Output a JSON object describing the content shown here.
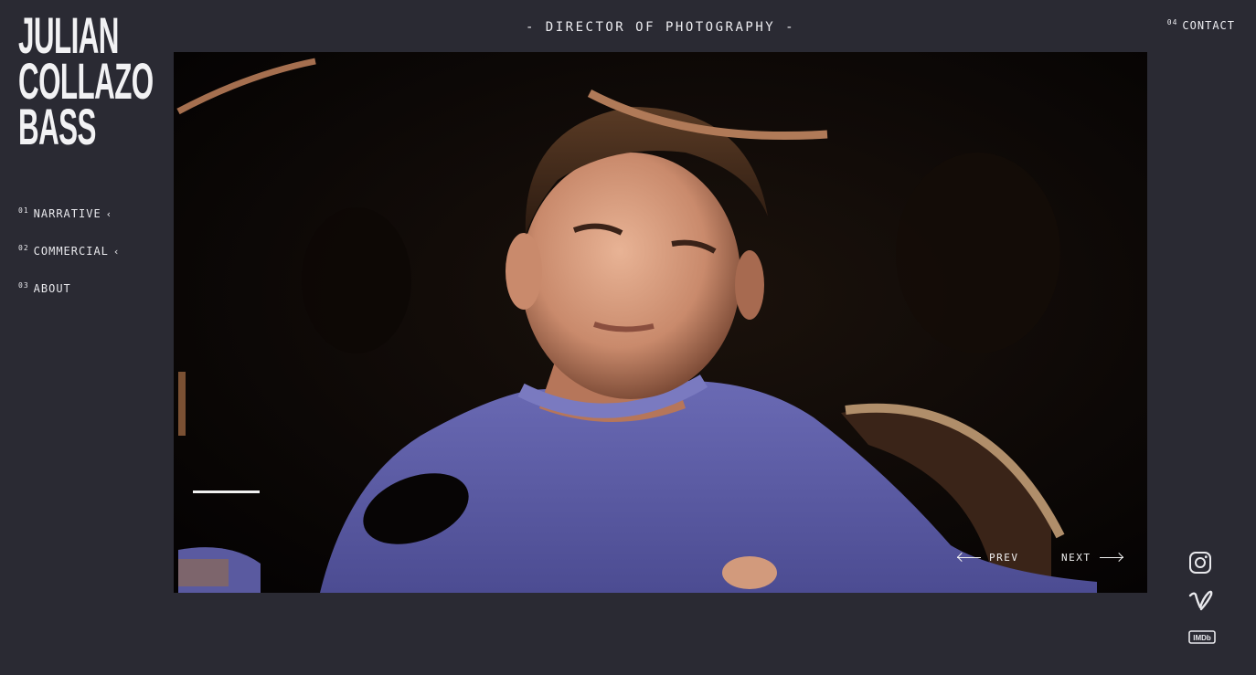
{
  "brand": {
    "logo_lines": [
      "JULIAN",
      "COLLAZO",
      "BASS"
    ]
  },
  "header": {
    "title": "- DIRECTOR OF PHOTOGRAPHY -"
  },
  "nav": [
    {
      "num": "01",
      "label": "NARRATIVE",
      "caret": "‹"
    },
    {
      "num": "02",
      "label": "COMMERCIAL",
      "caret": "‹"
    },
    {
      "num": "03",
      "label": "ABOUT",
      "caret": ""
    }
  ],
  "contact": {
    "num": "04",
    "label": "CONTACT"
  },
  "media": {
    "prev_label": "PREV",
    "next_label": "NEXT",
    "slide_progress": 0.07
  },
  "social": {
    "icons": [
      "instagram-icon",
      "vimeo-icon",
      "imdb-icon"
    ],
    "imdb_text": "IMDb"
  },
  "colors": {
    "background": "#2a2a33",
    "text": "#e8e8ec",
    "media_bg": "#000000"
  }
}
